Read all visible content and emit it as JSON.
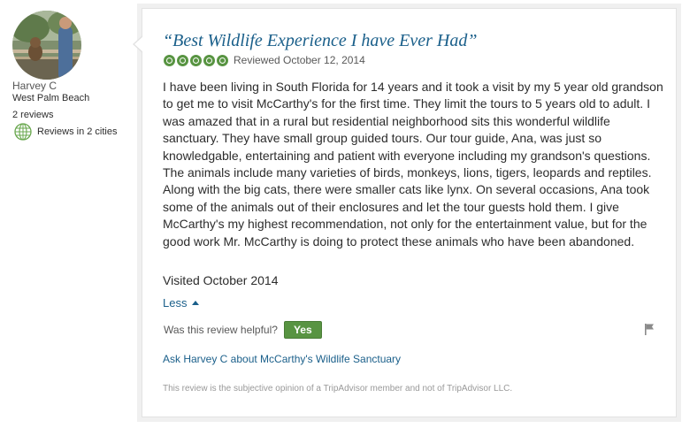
{
  "reviewer": {
    "name": "Harvey C",
    "location": "West Palm Beach",
    "review_count": "2 reviews",
    "cities": "Reviews in 2 cities",
    "avatar_icon": "reviewer-photo",
    "cities_icon": "globe-icon"
  },
  "review": {
    "title": "“Best Wildlife Experience I have Ever Had”",
    "rating": 5,
    "rating_max": 5,
    "date": "Reviewed October 12, 2014",
    "body": "I have been living in South Florida for 14 years and it took a visit by my 5 year old grandson to get me to visit McCarthy's for the first time. They limit the tours to 5 years old to adult. I was amazed that in a rural but residential neighborhood sits this wonderful wildlife sanctuary. They have small group guided tours. Our tour guide, Ana, was just so knowledgable, entertaining and patient with everyone including my grandson's questions. The animals include many varieties of birds, monkeys, lions, tigers, leopards and reptiles. Along with the big cats, there were smaller cats like lynx. On several occasions, Ana took some of the animals out of their enclosures and let the tour guests hold them. I give McCarthy's my highest recommendation, not only for the entertainment value, but for the good work Mr. McCarthy is doing to protect these animals who have been abandoned.",
    "visited": "Visited October 2014",
    "less_label": "Less",
    "helpful_question": "Was this review helpful?",
    "yes_label": "Yes",
    "ask_link": "Ask Harvey C about McCarthy's Wildlife Sanctuary",
    "disclaimer": "This review is the subjective opinion of a TripAdvisor member and not of TripAdvisor LLC."
  },
  "colors": {
    "link": "#1a5f8a",
    "rating_green": "#589442",
    "text": "#2c2c2c",
    "muted": "#999999"
  }
}
